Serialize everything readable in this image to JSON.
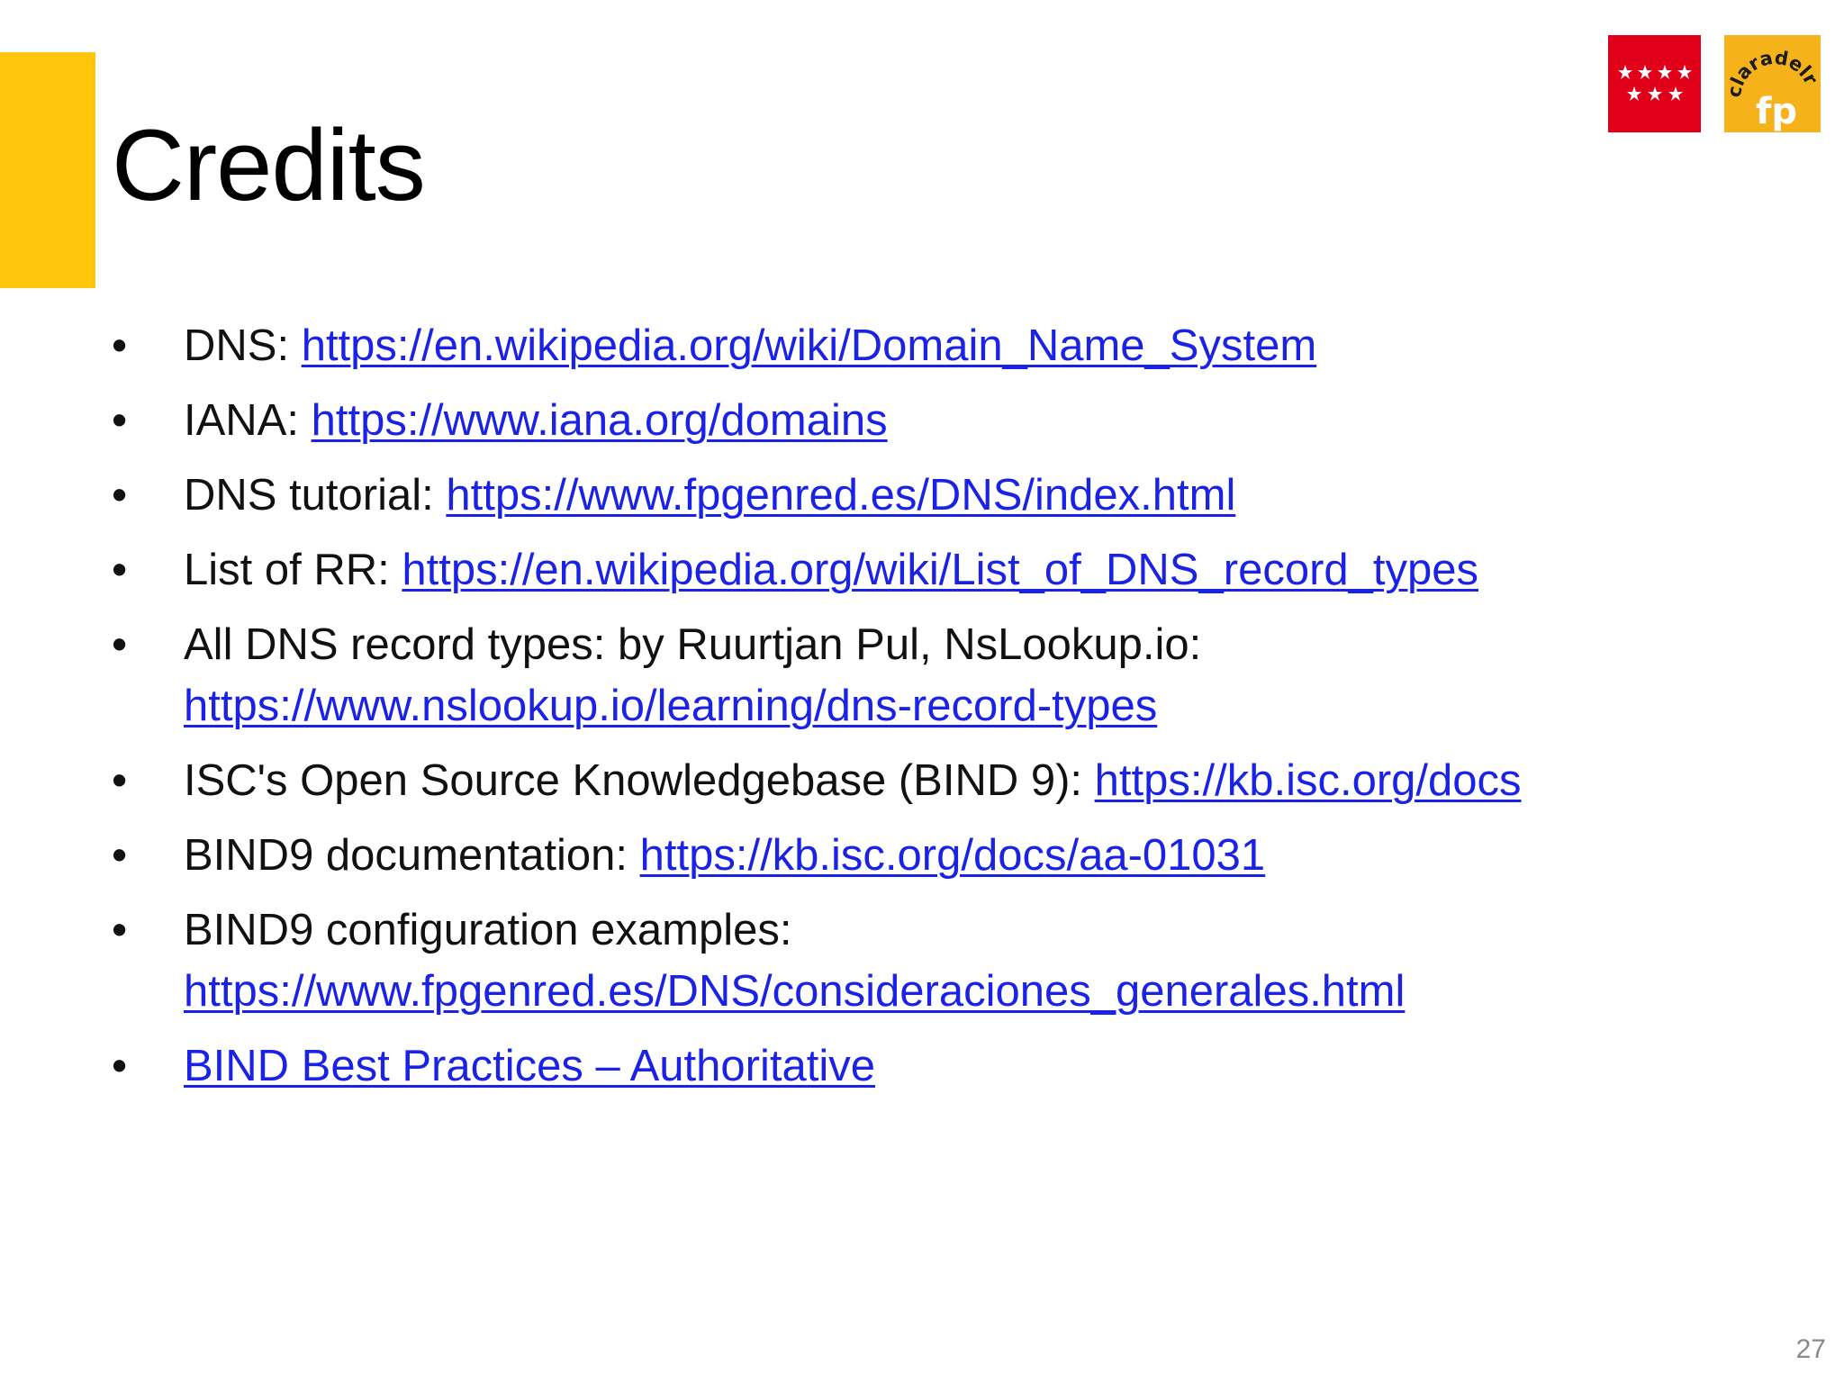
{
  "slide": {
    "title": "Credits",
    "page_number": "27",
    "accent_color": "#FFC60B",
    "link_color": "#1a22e6"
  },
  "logos": {
    "madrid": {
      "icon": "comunidad-de-madrid-stars-logo",
      "background": "#E1001A"
    },
    "fp": {
      "icon": "claradelrey-fp-logo",
      "background": "#F6B21B",
      "text_top": "claradelrey",
      "text_bottom": "fp"
    }
  },
  "credits": [
    {
      "label": "DNS: ",
      "link": "https://en.wikipedia.org/wiki/Domain_Name_System"
    },
    {
      "label": "IANA: ",
      "link": "https://www.iana.org/domains"
    },
    {
      "label": "DNS tutorial: ",
      "link": "https://www.fpgenred.es/DNS/index.html"
    },
    {
      "label": "List of RR: ",
      "link": "https://en.wikipedia.org/wiki/List_of_DNS_record_types"
    },
    {
      "label": "All DNS record types: by Ruurtjan Pul, NsLookup.io: ",
      "link": "https://www.nslookup.io/learning/dns-record-types"
    },
    {
      "label": "ISC's Open Source Knowledgebase (BIND 9): ",
      "link": "https://kb.isc.org/docs"
    },
    {
      "label": "BIND9 documentation: ",
      "link": "https://kb.isc.org/docs/aa-01031"
    },
    {
      "label": "BIND9 configuration examples: ",
      "link": "https://www.fpgenred.es/DNS/consideraciones_generales.html"
    },
    {
      "label": "",
      "link": "BIND Best Practices – Authoritative"
    }
  ]
}
